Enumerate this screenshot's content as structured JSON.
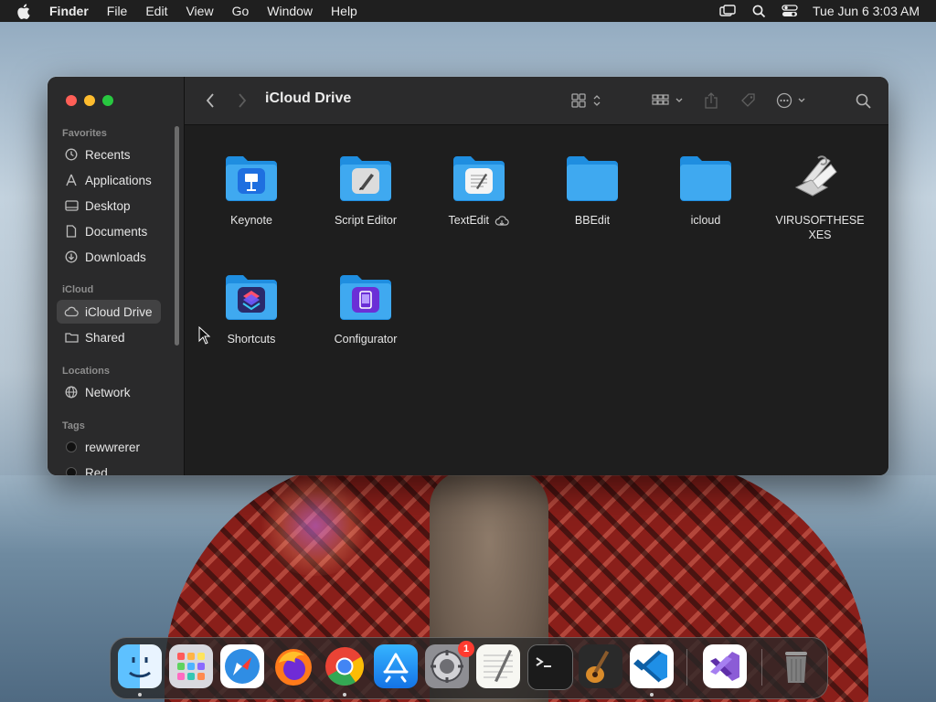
{
  "menubar": {
    "app_name": "Finder",
    "menus": [
      "File",
      "Edit",
      "View",
      "Go",
      "Window",
      "Help"
    ],
    "datetime": "Tue Jun 6  3:03 AM",
    "status_icons": [
      "screen-mirroring-icon",
      "spotlight-search-icon",
      "control-center-icon"
    ]
  },
  "window": {
    "title": "iCloud Drive",
    "sidebar": {
      "sections": {
        "favorites": "Favorites",
        "icloud": "iCloud",
        "locations": "Locations",
        "tags": "Tags"
      },
      "favorites": [
        {
          "label": "Recents",
          "icon": "clock-icon"
        },
        {
          "label": "Applications",
          "icon": "applications-icon"
        },
        {
          "label": "Desktop",
          "icon": "desktop-icon"
        },
        {
          "label": "Documents",
          "icon": "document-icon"
        },
        {
          "label": "Downloads",
          "icon": "download-icon"
        }
      ],
      "icloud": [
        {
          "label": "iCloud Drive",
          "icon": "cloud-icon",
          "selected": true
        },
        {
          "label": "Shared",
          "icon": "shared-folder-icon"
        }
      ],
      "locations": [
        {
          "label": "Network",
          "icon": "globe-icon"
        }
      ],
      "tags": [
        {
          "label": "rewwrerer",
          "color": "#111111"
        },
        {
          "label": "Red",
          "color": "#111111"
        }
      ]
    },
    "files": [
      {
        "name": "Keynote",
        "kind": "app-folder",
        "badge_color": "#1e6fe0"
      },
      {
        "name": "Script Editor",
        "kind": "app-folder",
        "badge_color": "#dcdcdc"
      },
      {
        "name": "TextEdit",
        "kind": "app-folder",
        "badge_color": "#f4f4f4",
        "cloud": true
      },
      {
        "name": "BBEdit",
        "kind": "folder"
      },
      {
        "name": "icloud",
        "kind": "folder"
      },
      {
        "name": "VIRUSOFTHESEXES",
        "kind": "script"
      },
      {
        "name": "Shortcuts",
        "kind": "app-folder",
        "badge_color": "#2a2a6a"
      },
      {
        "name": "Configurator",
        "kind": "app-folder",
        "badge_color": "#6b2fd6"
      }
    ]
  },
  "dock": {
    "apps": [
      {
        "name": "Finder",
        "icon": "finder-icon",
        "running": true
      },
      {
        "name": "Launchpad",
        "icon": "launchpad-icon"
      },
      {
        "name": "Safari",
        "icon": "safari-icon"
      },
      {
        "name": "Firefox",
        "icon": "firefox-icon"
      },
      {
        "name": "Chrome",
        "icon": "chrome-icon",
        "running": true
      },
      {
        "name": "App Store",
        "icon": "app-store-icon"
      },
      {
        "name": "System Settings",
        "icon": "system-settings-icon",
        "badge": "1"
      },
      {
        "name": "TextEdit",
        "icon": "textedit-icon"
      },
      {
        "name": "Terminal",
        "icon": "terminal-icon"
      },
      {
        "name": "Instruments",
        "icon": "guitar-icon"
      },
      {
        "name": "Visual Studio Code",
        "icon": "vscode-icon",
        "running": true
      },
      {
        "name": "Visual Studio",
        "icon": "visual-studio-icon"
      },
      {
        "name": "Trash",
        "icon": "trash-icon"
      }
    ]
  },
  "colors": {
    "folder_blue": "#3fa9f0",
    "selection": "#424243",
    "badge_red": "#ff3b30"
  }
}
